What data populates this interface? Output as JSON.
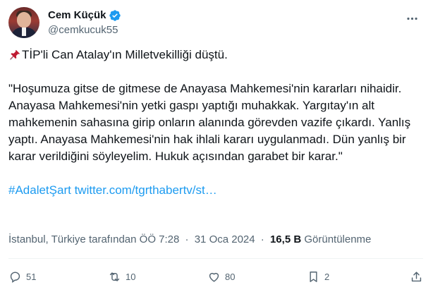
{
  "author": {
    "display_name": "Cem Küçük",
    "handle": "@cemkucuk55",
    "verified": true
  },
  "tweet": {
    "line1": "TİP'li Can Atalay'ın Milletvekilliği düştü.",
    "quote": "\"Hoşumuza gitse de gitmese de Anayasa Mahkemesi'nin kararları nihaidir. Anayasa Mahkemesi'nin yetki gaspı yaptığı muhakkak. Yargıtay'ın alt mahkemenin sahasına girip onların alanında görevden vazife çıkardı. Yanlış yaptı. Anayasa Mahkemesi'nin hak ihlali kararı uygulanmadı. Dün yanlış bir karar verildiğini söyleyelim. Hukuk açısından garabet bir karar.\"",
    "hashtag": "#AdaletŞart",
    "link": "twitter.com/tgrthabertv/st…"
  },
  "meta": {
    "location": "İstanbul, Türkiye tarafından",
    "time": "ÖÖ 7:28",
    "separator": "·",
    "date": "31 Oca 2024",
    "views_count": "16,5 B",
    "views_label": "Görüntülenme"
  },
  "actions": {
    "replies": "51",
    "retweets": "10",
    "likes": "80",
    "bookmarks": "2"
  },
  "colors": {
    "accent": "#1d9bf0",
    "text": "#0f1419",
    "secondary": "#536471"
  },
  "icons": [
    "verified-badge-icon",
    "more-icon",
    "pushpin-icon",
    "reply-icon",
    "retweet-icon",
    "like-icon",
    "bookmark-icon",
    "share-icon"
  ]
}
